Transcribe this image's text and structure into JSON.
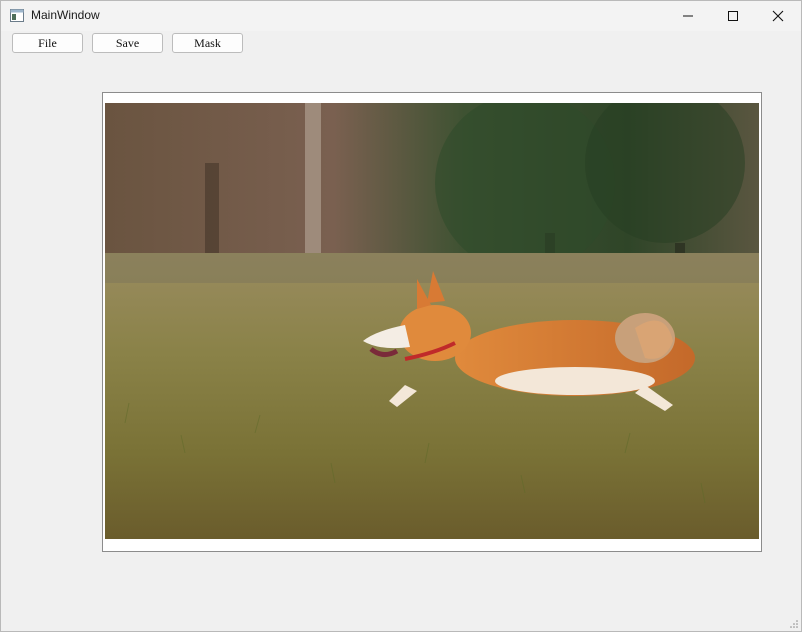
{
  "window": {
    "title": "MainWindow",
    "icons": {
      "app": "window-app-icon",
      "minimize": "minimize-icon",
      "maximize": "maximize-icon",
      "close": "close-icon"
    }
  },
  "toolbar": {
    "file_label": "File",
    "save_label": "Save",
    "mask_label": "Mask"
  },
  "image": {
    "subject": "corgi running on grass",
    "colors": {
      "sky_trees": "#4a5a3a",
      "grass": "#8c8a4a",
      "dog_fur": "#d27a36"
    }
  }
}
